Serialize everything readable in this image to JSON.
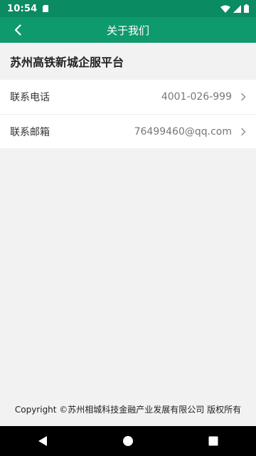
{
  "status_bar": {
    "time": "10:54",
    "icons": [
      "sd-card-icon",
      "wifi-icon",
      "signal-icon",
      "battery-icon"
    ]
  },
  "app_bar": {
    "back_icon": "chevron-left-icon",
    "title": "关于我们"
  },
  "platform_name": "苏州高铁新城企服平台",
  "contacts": [
    {
      "label": "联系电话",
      "value": "4001-026-999",
      "icon": "chevron-right-icon"
    },
    {
      "label": "联系邮箱",
      "value": "76499460@qq.com",
      "icon": "chevron-right-icon"
    }
  ],
  "copyright": "Copyright ©苏州相城科技金融产业发展有限公司 版权所有",
  "nav_bar": {
    "buttons": [
      "back-triangle-icon",
      "home-circle-icon",
      "recents-square-icon"
    ]
  },
  "colors": {
    "status_bar": "#0a8b61",
    "app_bar": "#0e9a6c",
    "background": "#f2f2f2"
  }
}
